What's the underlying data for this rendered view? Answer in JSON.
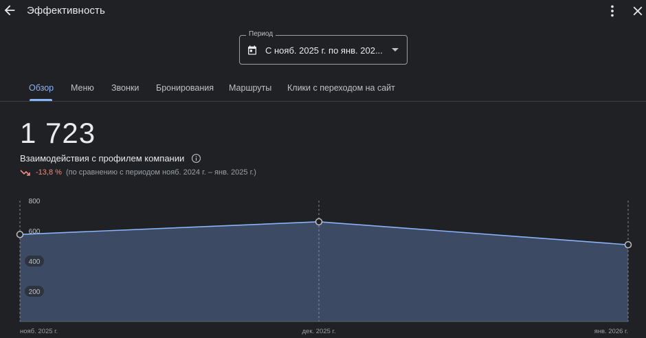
{
  "header": {
    "title": "Эффективность",
    "back_icon": "arrow-left-icon",
    "more_icon": "more-vert-icon",
    "close_icon": "close-icon"
  },
  "period": {
    "label": "Период",
    "value": "С нояб. 2025 г. по янв. 202...",
    "icon": "calendar-icon"
  },
  "tabs": [
    {
      "label": "Обзор",
      "active": true
    },
    {
      "label": "Меню",
      "active": false
    },
    {
      "label": "Звонки",
      "active": false
    },
    {
      "label": "Бронирования",
      "active": false
    },
    {
      "label": "Маршруты",
      "active": false
    },
    {
      "label": "Клики с переходом на сайт",
      "active": false
    }
  ],
  "metric": {
    "value": "1 723",
    "label": "Взаимодействия с профилем компании",
    "change": "-13,8 %",
    "comparison": "(по сравнению с периодом нояб. 2024 г. – янв. 2025 г.)"
  },
  "colors": {
    "accent": "#8ab4f8",
    "negative": "#f28b82",
    "area_fill": "#3c4a63",
    "line": "#8ab4f8"
  },
  "chart_data": {
    "type": "area",
    "categories": [
      "нояб. 2025 г.",
      "дек. 2025 г.",
      "янв. 2026 г."
    ],
    "values": [
      576,
      660,
      508
    ],
    "y_ticks": [
      200,
      400,
      600,
      800
    ],
    "ylim": [
      0,
      800
    ],
    "grid": false
  }
}
